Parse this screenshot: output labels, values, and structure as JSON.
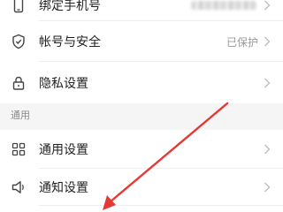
{
  "rows": [
    {
      "label": "绑定手机号",
      "icon": "phone-icon",
      "value_hidden": true
    },
    {
      "label": "帐号与安全",
      "icon": "shield-check-icon",
      "value": "已保护"
    },
    {
      "label": "隐私设置",
      "icon": "lock-icon"
    },
    {
      "label": "通用设置",
      "icon": "grid-icon"
    },
    {
      "label": "通知设置",
      "icon": "speaker-icon"
    }
  ],
  "section_general": "通用",
  "annotation": {
    "color": "#e53935",
    "icon": "arrow-annotation"
  }
}
